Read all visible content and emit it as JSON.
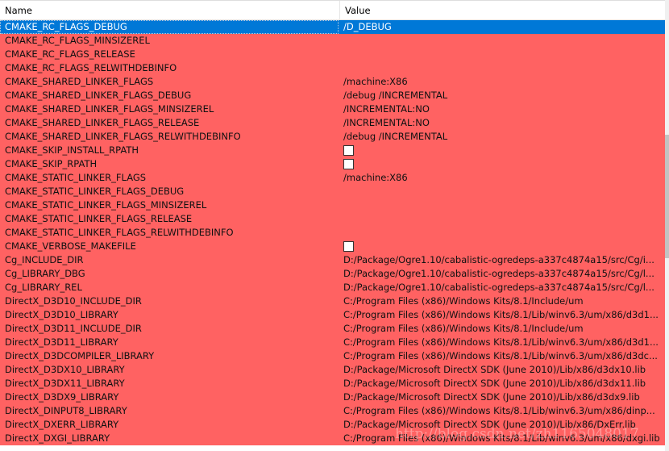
{
  "columns": {
    "name": "Name",
    "value": "Value"
  },
  "selected_index": 0,
  "colors": {
    "changed_row": "#ff6262",
    "selected_row": "#0078d7"
  },
  "rows": [
    {
      "name": "CMAKE_RC_FLAGS_DEBUG",
      "value": "/D_DEBUG"
    },
    {
      "name": "CMAKE_RC_FLAGS_MINSIZEREL",
      "value": ""
    },
    {
      "name": "CMAKE_RC_FLAGS_RELEASE",
      "value": ""
    },
    {
      "name": "CMAKE_RC_FLAGS_RELWITHDEBINFO",
      "value": ""
    },
    {
      "name": "CMAKE_SHARED_LINKER_FLAGS",
      "value": "/machine:X86"
    },
    {
      "name": "CMAKE_SHARED_LINKER_FLAGS_DEBUG",
      "value": "/debug /INCREMENTAL"
    },
    {
      "name": "CMAKE_SHARED_LINKER_FLAGS_MINSIZEREL",
      "value": "/INCREMENTAL:NO"
    },
    {
      "name": "CMAKE_SHARED_LINKER_FLAGS_RELEASE",
      "value": "/INCREMENTAL:NO"
    },
    {
      "name": "CMAKE_SHARED_LINKER_FLAGS_RELWITHDEBINFO",
      "value": "/debug /INCREMENTAL"
    },
    {
      "name": "CMAKE_SKIP_INSTALL_RPATH",
      "checkbox": true,
      "checked": false
    },
    {
      "name": "CMAKE_SKIP_RPATH",
      "checkbox": true,
      "checked": false
    },
    {
      "name": "CMAKE_STATIC_LINKER_FLAGS",
      "value": "/machine:X86"
    },
    {
      "name": "CMAKE_STATIC_LINKER_FLAGS_DEBUG",
      "value": ""
    },
    {
      "name": "CMAKE_STATIC_LINKER_FLAGS_MINSIZEREL",
      "value": ""
    },
    {
      "name": "CMAKE_STATIC_LINKER_FLAGS_RELEASE",
      "value": ""
    },
    {
      "name": "CMAKE_STATIC_LINKER_FLAGS_RELWITHDEBINFO",
      "value": ""
    },
    {
      "name": "CMAKE_VERBOSE_MAKEFILE",
      "checkbox": true,
      "checked": false
    },
    {
      "name": "Cg_INCLUDE_DIR",
      "value": "D:/Package/Ogre1.10/cabalistic-ogredeps-a337c4874a15/src/Cg/i..."
    },
    {
      "name": "Cg_LIBRARY_DBG",
      "value": "D:/Package/Ogre1.10/cabalistic-ogredeps-a337c4874a15/src/Cg/l..."
    },
    {
      "name": "Cg_LIBRARY_REL",
      "value": "D:/Package/Ogre1.10/cabalistic-ogredeps-a337c4874a15/src/Cg/l..."
    },
    {
      "name": "DirectX_D3D10_INCLUDE_DIR",
      "value": "C:/Program Files (x86)/Windows Kits/8.1/Include/um"
    },
    {
      "name": "DirectX_D3D10_LIBRARY",
      "value": "C:/Program Files (x86)/Windows Kits/8.1/Lib/winv6.3/um/x86/d3d1..."
    },
    {
      "name": "DirectX_D3D11_INCLUDE_DIR",
      "value": "C:/Program Files (x86)/Windows Kits/8.1/Include/um"
    },
    {
      "name": "DirectX_D3D11_LIBRARY",
      "value": "C:/Program Files (x86)/Windows Kits/8.1/Lib/winv6.3/um/x86/d3d1..."
    },
    {
      "name": "DirectX_D3DCOMPILER_LIBRARY",
      "value": "C:/Program Files (x86)/Windows Kits/8.1/Lib/winv6.3/um/x86/d3dc..."
    },
    {
      "name": "DirectX_D3DX10_LIBRARY",
      "value": "D:/Package/Microsoft DirectX SDK (June 2010)/Lib/x86/d3dx10.lib"
    },
    {
      "name": "DirectX_D3DX11_LIBRARY",
      "value": "D:/Package/Microsoft DirectX SDK (June 2010)/Lib/x86/d3dx11.lib"
    },
    {
      "name": "DirectX_D3DX9_LIBRARY",
      "value": "D:/Package/Microsoft DirectX SDK (June 2010)/Lib/x86/d3dx9.lib"
    },
    {
      "name": "DirectX_DINPUT8_LIBRARY",
      "value": "C:/Program Files (x86)/Windows Kits/8.1/Lib/winv6.3/um/x86/dinp..."
    },
    {
      "name": "DirectX_DXERR_LIBRARY",
      "value": "D:/Package/Microsoft DirectX SDK (June 2010)/Lib/x86/DxErr.lib"
    },
    {
      "name": "DirectX_DXGI_LIBRARY",
      "value": "C:/Program Files (x86)/Windows Kits/8.1/Lib/winv6.3/um/x86/dxgi.lib"
    }
  ],
  "watermark": "http://blog.csdn.net/zh1165048017"
}
